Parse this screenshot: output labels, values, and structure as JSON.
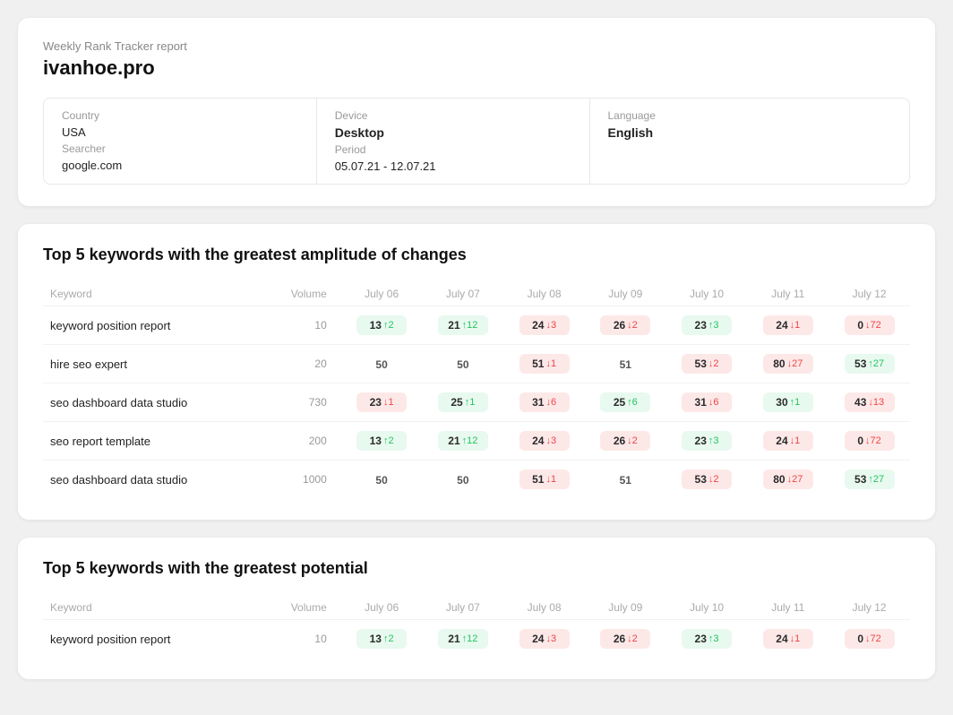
{
  "report": {
    "subtitle": "Weekly Rank Tracker report",
    "domain": "ivanhoe.pro",
    "meta": {
      "country_label": "Country",
      "country_value": "USA",
      "searcher_label": "Searcher",
      "searcher_value": "google.com",
      "device_label": "Device",
      "device_value": "Desktop",
      "period_label": "Period",
      "period_value": "05.07.21 - 12.07.21",
      "language_label": "Language",
      "language_value": "English"
    }
  },
  "amplitude_section": {
    "title": "Top 5 keywords with the greatest amplitude of changes",
    "columns": [
      "Keyword",
      "Volume",
      "July 06",
      "July 07",
      "July 08",
      "July 09",
      "July 10",
      "July 11",
      "July 12"
    ],
    "rows": [
      {
        "keyword": "keyword position report",
        "volume": "10",
        "cells": [
          {
            "val": "13",
            "change": "+2",
            "dir": "up",
            "style": "green"
          },
          {
            "val": "21",
            "change": "+12",
            "dir": "up",
            "style": "green"
          },
          {
            "val": "24",
            "change": "-3",
            "dir": "down",
            "style": "red"
          },
          {
            "val": "26",
            "change": "-2",
            "dir": "down",
            "style": "red"
          },
          {
            "val": "23",
            "change": "+3",
            "dir": "up",
            "style": "green"
          },
          {
            "val": "24",
            "change": "-1",
            "dir": "down",
            "style": "red"
          },
          {
            "val": "0",
            "change": "-72",
            "dir": "down",
            "style": "red"
          }
        ]
      },
      {
        "keyword": "hire seo expert",
        "volume": "20",
        "cells": [
          {
            "val": "50",
            "change": "",
            "dir": "",
            "style": "plain"
          },
          {
            "val": "50",
            "change": "",
            "dir": "",
            "style": "plain"
          },
          {
            "val": "51",
            "change": "-1",
            "dir": "down",
            "style": "red"
          },
          {
            "val": "51",
            "change": "",
            "dir": "",
            "style": "plain"
          },
          {
            "val": "53",
            "change": "-2",
            "dir": "down",
            "style": "red"
          },
          {
            "val": "80",
            "change": "-27",
            "dir": "down",
            "style": "red"
          },
          {
            "val": "53",
            "change": "+27",
            "dir": "up",
            "style": "green"
          }
        ]
      },
      {
        "keyword": "seo dashboard data studio",
        "volume": "730",
        "cells": [
          {
            "val": "23",
            "change": "-1",
            "dir": "down",
            "style": "red"
          },
          {
            "val": "25",
            "change": "+1",
            "dir": "up",
            "style": "green"
          },
          {
            "val": "31",
            "change": "-6",
            "dir": "down",
            "style": "red"
          },
          {
            "val": "25",
            "change": "+6",
            "dir": "up",
            "style": "green"
          },
          {
            "val": "31",
            "change": "-6",
            "dir": "down",
            "style": "red"
          },
          {
            "val": "30",
            "change": "+1",
            "dir": "up",
            "style": "green"
          },
          {
            "val": "43",
            "change": "-13",
            "dir": "down",
            "style": "red"
          }
        ]
      },
      {
        "keyword": "seo report template",
        "volume": "200",
        "cells": [
          {
            "val": "13",
            "change": "+2",
            "dir": "up",
            "style": "green"
          },
          {
            "val": "21",
            "change": "+12",
            "dir": "up",
            "style": "green"
          },
          {
            "val": "24",
            "change": "-3",
            "dir": "down",
            "style": "red"
          },
          {
            "val": "26",
            "change": "-2",
            "dir": "down",
            "style": "red"
          },
          {
            "val": "23",
            "change": "+3",
            "dir": "up",
            "style": "green"
          },
          {
            "val": "24",
            "change": "-1",
            "dir": "down",
            "style": "red"
          },
          {
            "val": "0",
            "change": "-72",
            "dir": "down",
            "style": "red"
          }
        ]
      },
      {
        "keyword": "seo dashboard data studio",
        "volume": "1000",
        "cells": [
          {
            "val": "50",
            "change": "",
            "dir": "",
            "style": "plain"
          },
          {
            "val": "50",
            "change": "",
            "dir": "",
            "style": "plain"
          },
          {
            "val": "51",
            "change": "-1",
            "dir": "down",
            "style": "red"
          },
          {
            "val": "51",
            "change": "",
            "dir": "",
            "style": "plain"
          },
          {
            "val": "53",
            "change": "-2",
            "dir": "down",
            "style": "red"
          },
          {
            "val": "80",
            "change": "-27",
            "dir": "down",
            "style": "red"
          },
          {
            "val": "53",
            "change": "+27",
            "dir": "up",
            "style": "green"
          }
        ]
      }
    ]
  },
  "potential_section": {
    "title": "Top 5 keywords with the greatest potential",
    "columns": [
      "Keyword",
      "Volume",
      "July 06",
      "July 07",
      "July 08",
      "July 09",
      "July 10",
      "July 11",
      "July 12"
    ],
    "rows": [
      {
        "keyword": "keyword position report",
        "volume": "10",
        "cells": [
          {
            "val": "13",
            "change": "+2",
            "dir": "up",
            "style": "green"
          },
          {
            "val": "21",
            "change": "+12",
            "dir": "up",
            "style": "green"
          },
          {
            "val": "24",
            "change": "-3",
            "dir": "down",
            "style": "red"
          },
          {
            "val": "26",
            "change": "-2",
            "dir": "down",
            "style": "red"
          },
          {
            "val": "23",
            "change": "+3",
            "dir": "up",
            "style": "green"
          },
          {
            "val": "24",
            "change": "-1",
            "dir": "down",
            "style": "red"
          },
          {
            "val": "0",
            "change": "-72",
            "dir": "down",
            "style": "red"
          }
        ]
      }
    ]
  }
}
